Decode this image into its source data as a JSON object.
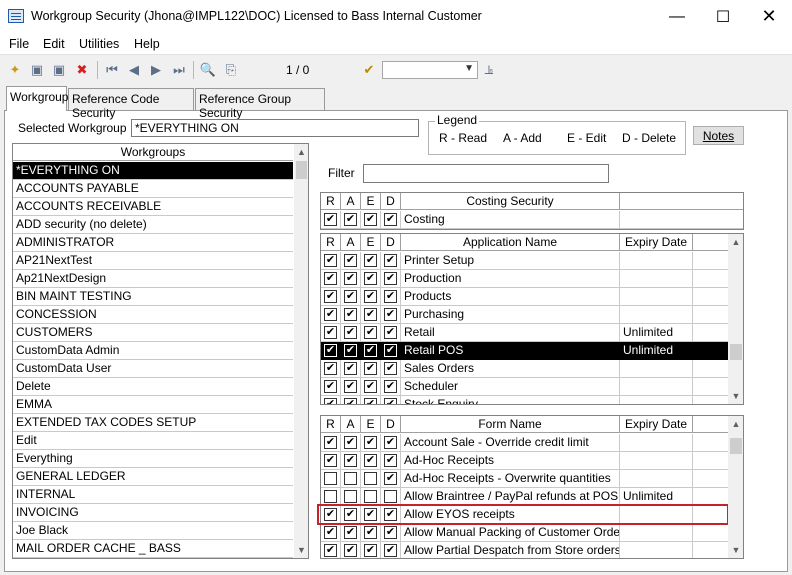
{
  "window": {
    "title": "Workgroup Security (Jhona@IMPL122\\DOC) Licensed to Bass Internal Customer"
  },
  "menu": [
    "File",
    "Edit",
    "Utilities",
    "Help"
  ],
  "toolbar": {
    "page_indicator": "1 / 0",
    "combo_value": ""
  },
  "tabs": [
    "Workgroup",
    "Reference Code Security",
    "Reference Group Security"
  ],
  "selected_workgroup": {
    "label": "Selected Workgroup :",
    "value": "*EVERYTHING ON"
  },
  "legend": {
    "title": "Legend",
    "items": [
      "R - Read",
      "A - Add",
      "E - Edit",
      "D - Delete"
    ]
  },
  "notes_button": "Notes",
  "filter_label": "Filter",
  "workgroups": {
    "header": "Workgroups",
    "items": [
      "*EVERYTHING ON",
      "ACCOUNTS PAYABLE",
      "ACCOUNTS RECEIVABLE",
      "ADD security (no delete)",
      "ADMINISTRATOR",
      "AP21NextTest",
      "Ap21NextDesign",
      "BIN MAINT TESTING",
      "CONCESSION",
      "CUSTOMERS",
      "CustomData Admin",
      "CustomData User",
      "Delete",
      "EMMA",
      "EXTENDED TAX CODES SETUP",
      "Edit",
      "Everything",
      "GENERAL LEDGER",
      "INTERNAL",
      "INVOICING",
      "Joe Black",
      "MAIL ORDER CACHE _ BASS"
    ],
    "selected": "*EVERYTHING ON"
  },
  "costing": {
    "headers": [
      "R",
      "A",
      "E",
      "D",
      "Costing Security"
    ],
    "rows": [
      {
        "name": "Costing",
        "r": true,
        "a": true,
        "e": true,
        "d": true
      }
    ]
  },
  "applications": {
    "headers": [
      "R",
      "A",
      "E",
      "D",
      "Application Name",
      "Expiry Date"
    ],
    "rows": [
      {
        "name": "Printer Setup",
        "expiry": "",
        "r": true,
        "a": true,
        "e": true,
        "d": true
      },
      {
        "name": "Production",
        "expiry": "",
        "r": true,
        "a": true,
        "e": true,
        "d": true
      },
      {
        "name": "Products",
        "expiry": "",
        "r": true,
        "a": true,
        "e": true,
        "d": true
      },
      {
        "name": "Purchasing",
        "expiry": "",
        "r": true,
        "a": true,
        "e": true,
        "d": true
      },
      {
        "name": "Retail",
        "expiry": "Unlimited",
        "r": true,
        "a": true,
        "e": true,
        "d": true
      },
      {
        "name": "Retail POS",
        "expiry": "Unlimited",
        "r": true,
        "a": true,
        "e": true,
        "d": true,
        "selected": true
      },
      {
        "name": "Sales Orders",
        "expiry": "",
        "r": true,
        "a": true,
        "e": true,
        "d": true
      },
      {
        "name": "Scheduler",
        "expiry": "",
        "r": true,
        "a": true,
        "e": true,
        "d": true
      },
      {
        "name": "Stock Enquiry",
        "expiry": "",
        "r": true,
        "a": true,
        "e": true,
        "d": true
      }
    ]
  },
  "forms": {
    "headers": [
      "R",
      "A",
      "E",
      "D",
      "Form Name",
      "Expiry Date"
    ],
    "rows": [
      {
        "name": "Account Sale - Override credit limit",
        "expiry": "",
        "r": true,
        "a": true,
        "e": true,
        "d": true
      },
      {
        "name": "Ad-Hoc Receipts",
        "expiry": "",
        "r": true,
        "a": true,
        "e": true,
        "d": true
      },
      {
        "name": "Ad-Hoc Receipts - Overwrite quantities",
        "expiry": "",
        "r": false,
        "a": false,
        "e": false,
        "d": true
      },
      {
        "name": "Allow Braintree / PayPal refunds at POS",
        "expiry": "Unlimited",
        "r": false,
        "a": false,
        "e": false,
        "d": false
      },
      {
        "name": "Allow EYOS receipts",
        "expiry": "",
        "r": true,
        "a": true,
        "e": true,
        "d": true,
        "highlighted": true
      },
      {
        "name": "Allow Manual Packing of Customer Orders",
        "expiry": "",
        "r": true,
        "a": true,
        "e": true,
        "d": true
      },
      {
        "name": "Allow Partial Despatch from Store orders",
        "expiry": "",
        "r": true,
        "a": true,
        "e": true,
        "d": true
      }
    ]
  },
  "colors": {
    "selection": "#000000",
    "highlight_box": "#c8212a",
    "toolbar_icon": "#5c6e88"
  }
}
